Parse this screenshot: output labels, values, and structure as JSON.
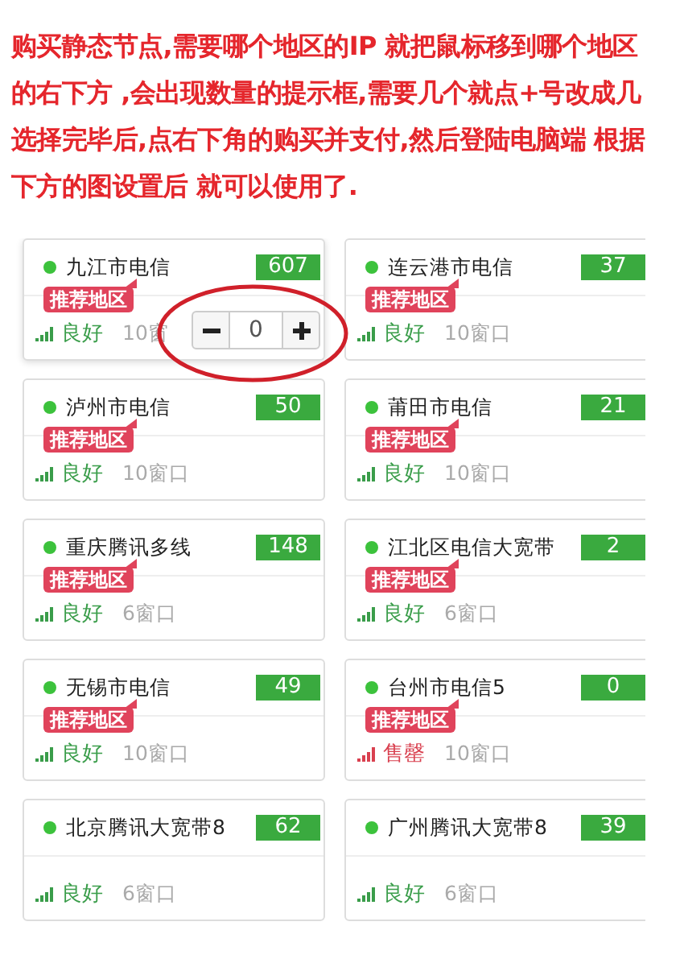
{
  "instructions": {
    "lines": [
      "购买静态节点,需要哪个地区的IP 就把鼠标移到哪个地区",
      "的右下方 ,会出现数量的提示框,需要几个就点+号改成几",
      "选择完毕后,点右下角的购买并支付,然后登陆电脑端 根据",
      "下方的图设置后 就可以使用了."
    ]
  },
  "nodes": [
    {
      "name": "九江市电信",
      "count": "607",
      "recommended": true,
      "tag": "推荐地区",
      "status": "良好",
      "kind": "good",
      "windows": "10窗",
      "stepper": {
        "value": "0"
      },
      "annotated": true
    },
    {
      "name": "连云港市电信",
      "count": "37",
      "recommended": true,
      "tag": "推荐地区",
      "status": "良好",
      "kind": "good",
      "windows": "10窗口"
    },
    {
      "name": "泸州市电信",
      "count": "50",
      "recommended": true,
      "tag": "推荐地区",
      "status": "良好",
      "kind": "good",
      "windows": "10窗口"
    },
    {
      "name": "莆田市电信",
      "count": "21",
      "recommended": true,
      "tag": "推荐地区",
      "status": "良好",
      "kind": "good",
      "windows": "10窗口"
    },
    {
      "name": "重庆腾讯多线",
      "count": "148",
      "recommended": true,
      "tag": "推荐地区",
      "status": "良好",
      "kind": "good",
      "windows": "6窗口"
    },
    {
      "name": "江北区电信大宽带",
      "count": "2",
      "recommended": true,
      "tag": "推荐地区",
      "status": "良好",
      "kind": "good",
      "windows": "6窗口"
    },
    {
      "name": "无锡市电信",
      "count": "49",
      "recommended": true,
      "tag": "推荐地区",
      "status": "良好",
      "kind": "good",
      "windows": "10窗口"
    },
    {
      "name": "台州市电信5",
      "count": "0",
      "recommended": true,
      "tag": "推荐地区",
      "status": "售罄",
      "kind": "soldout",
      "windows": "10窗口"
    },
    {
      "name": "北京腾讯大宽带8",
      "count": "62",
      "recommended": false,
      "status": "良好",
      "kind": "good",
      "windows": "6窗口"
    },
    {
      "name": "广州腾讯大宽带8",
      "count": "39",
      "recommended": false,
      "status": "良好",
      "kind": "good",
      "windows": "6窗口"
    }
  ]
}
